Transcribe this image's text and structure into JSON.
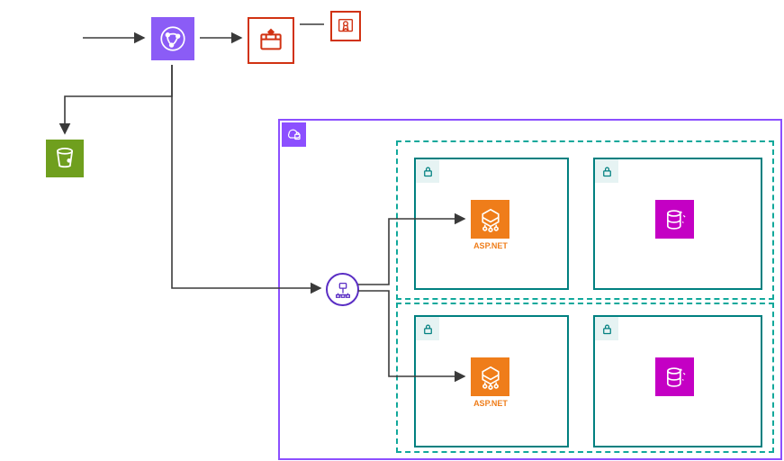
{
  "colors": {
    "cloudfront": "#8b5cf6",
    "waf": "#d13212",
    "certmgr": "#d13212",
    "s3": "#6f9f1e",
    "vpc": "#8c4fff",
    "lock": "#008080",
    "subnet": "#11a89b",
    "az": "#11a89b",
    "app": "#ef7d1a",
    "db": "#c400c4",
    "elb": "#5a2ec4",
    "arrow": "#3a3a3a"
  },
  "labels": {
    "aspnet": "ASP.NET"
  },
  "icons": {
    "cloudfront": "cloudfront-icon",
    "waf": "waf-icon",
    "cert": "certificate-manager-icon",
    "s3": "s3-bucket-icon",
    "vpc": "vpc-icon",
    "lock": "lock-icon",
    "app": "app-server-icon",
    "db": "database-icon",
    "elb": "load-balancer-icon"
  }
}
